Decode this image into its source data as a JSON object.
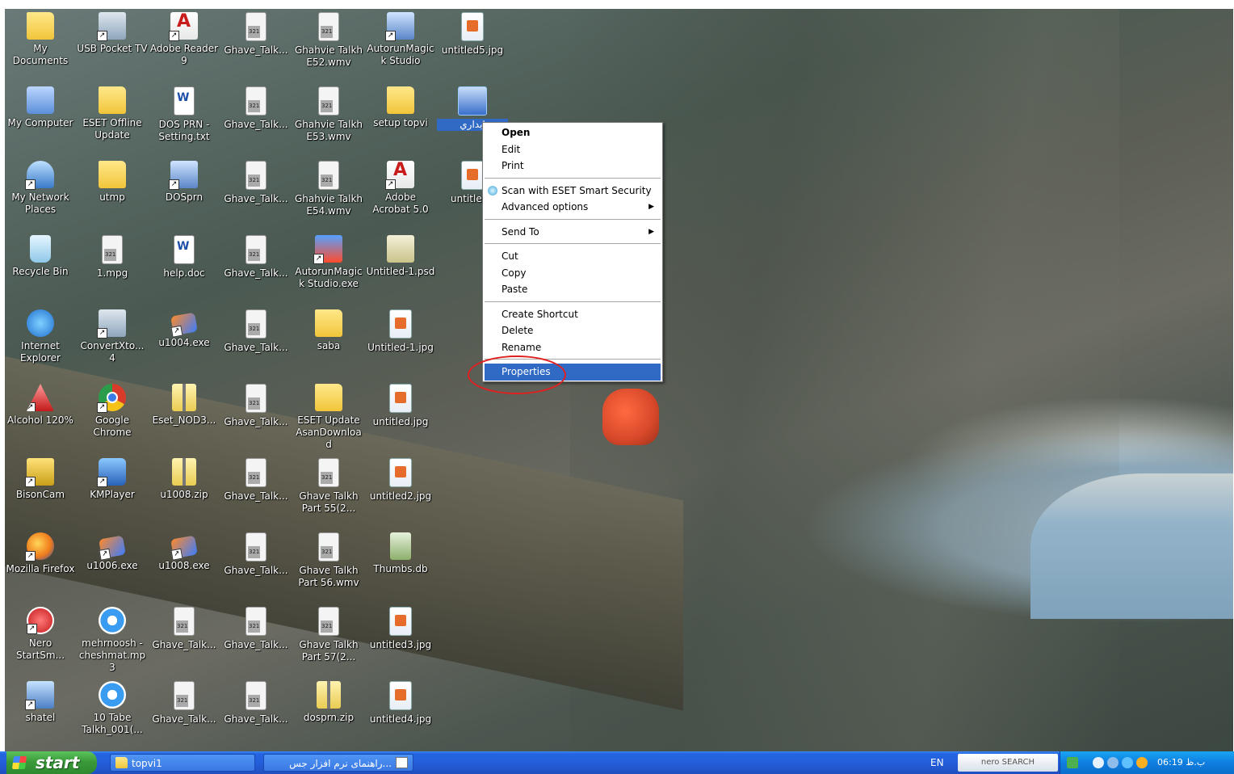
{
  "desktop_icons": [
    {
      "label": "My Documents",
      "kind": "folder"
    },
    {
      "label": "USB Pocket TV",
      "kind": "generic"
    },
    {
      "label": "Adobe Reader 9",
      "kind": "pdf"
    },
    {
      "label": "Ghave_Talk...",
      "kind": "video"
    },
    {
      "label": "Ghahvie Talkh E52.wmv",
      "kind": "video"
    },
    {
      "label": "AutorunMagick Studio",
      "kind": "app"
    },
    {
      "label": "untitled5.jpg",
      "kind": "jpg"
    },
    {
      "label": "My Computer",
      "kind": "pc"
    },
    {
      "label": "ESET Offline Update",
      "kind": "folder"
    },
    {
      "label": "DOS PRN - Setting.txt",
      "kind": "doc"
    },
    {
      "label": "Ghave_Talk...",
      "kind": "video"
    },
    {
      "label": "Ghahvie Talkh E53.wmv",
      "kind": "video"
    },
    {
      "label": "setup topvi",
      "kind": "folder"
    },
    {
      "label": "ابداري",
      "kind": "selected"
    },
    {
      "label": "My Network Places",
      "kind": "net"
    },
    {
      "label": "utmp",
      "kind": "folder"
    },
    {
      "label": "DOSprn",
      "kind": "app"
    },
    {
      "label": "Ghave_Talk...",
      "kind": "video"
    },
    {
      "label": "Ghahvie Talkh E54.wmv",
      "kind": "video"
    },
    {
      "label": "Adobe Acrobat 5.0",
      "kind": "pdf"
    },
    {
      "label": "untitled6",
      "kind": "jpg"
    },
    {
      "label": "Recycle Bin",
      "kind": "bin"
    },
    {
      "label": "1.mpg",
      "kind": "video"
    },
    {
      "label": "help.doc",
      "kind": "doc"
    },
    {
      "label": "Ghave_Talk...",
      "kind": "video"
    },
    {
      "label": "AutorunMagick Studio.exe",
      "kind": "mrt"
    },
    {
      "label": "Untitled-1.psd",
      "kind": "psd"
    },
    {
      "label": "Internet Explorer",
      "kind": "ie"
    },
    {
      "label": "ConvertXto... 4",
      "kind": "generic"
    },
    {
      "label": "u1004.exe",
      "kind": "exe"
    },
    {
      "label": "Ghave_Talk...",
      "kind": "video"
    },
    {
      "label": "saba",
      "kind": "folder"
    },
    {
      "label": "Untitled-1.jpg",
      "kind": "jpg"
    },
    {
      "label": "Alcohol 120%",
      "kind": "alcohol"
    },
    {
      "label": "Google Chrome",
      "kind": "chrome"
    },
    {
      "label": "Eset_NOD3...",
      "kind": "zip"
    },
    {
      "label": "Ghave_Talk...",
      "kind": "video"
    },
    {
      "label": "ESET Update AsanDownload",
      "kind": "folder"
    },
    {
      "label": "untitled.jpg",
      "kind": "jpg"
    },
    {
      "label": "BisonCam",
      "kind": "bison"
    },
    {
      "label": "KMPlayer",
      "kind": "kmp"
    },
    {
      "label": "u1008.zip",
      "kind": "zip"
    },
    {
      "label": "Ghave_Talk...",
      "kind": "video"
    },
    {
      "label": "Ghave Talkh Part 55(2...",
      "kind": "video"
    },
    {
      "label": "untitled2.jpg",
      "kind": "jpg"
    },
    {
      "label": "Mozilla Firefox",
      "kind": "ff"
    },
    {
      "label": "u1006.exe",
      "kind": "exe"
    },
    {
      "label": "u1008.exe",
      "kind": "exe"
    },
    {
      "label": "Ghave_Talk...",
      "kind": "video"
    },
    {
      "label": "Ghave Talkh Part 56.wmv",
      "kind": "video"
    },
    {
      "label": "Thumbs.db",
      "kind": "db"
    },
    {
      "label": "Nero StartSm...",
      "kind": "nero"
    },
    {
      "label": "mehrnoosh - cheshmat.mp3",
      "kind": "media"
    },
    {
      "label": "Ghave_Talk...",
      "kind": "video"
    },
    {
      "label": "Ghave_Talk...",
      "kind": "video"
    },
    {
      "label": "Ghave Talkh Part 57(2...",
      "kind": "video"
    },
    {
      "label": "untitled3.jpg",
      "kind": "jpg"
    },
    {
      "label": "shatel",
      "kind": "shatel"
    },
    {
      "label": "10 Tabe Talkh_001(...",
      "kind": "media"
    },
    {
      "label": "Ghave_Talk...",
      "kind": "video"
    },
    {
      "label": "Ghave_Talk...",
      "kind": "video"
    },
    {
      "label": "dosprn.zip",
      "kind": "zip"
    },
    {
      "label": "untitled4.jpg",
      "kind": "jpg"
    }
  ],
  "context_menu": {
    "open": "Open",
    "edit": "Edit",
    "print": "Print",
    "scan": "Scan with ESET Smart Security",
    "advanced": "Advanced options",
    "send_to": "Send To",
    "cut": "Cut",
    "copy": "Copy",
    "paste": "Paste",
    "create_shortcut": "Create Shortcut",
    "delete": "Delete",
    "rename": "Rename",
    "properties": "Properties"
  },
  "taskbar": {
    "start_label": "start",
    "tasks": [
      "topvi1",
      "...راهنمای نرم افزار جس"
    ],
    "lang": "EN",
    "nero_search": "nero SEARCH",
    "clock": "06:19 ب.ظ"
  },
  "colors": {
    "selection": "#316ac5",
    "highlight_circle": "#e02020",
    "taskbar": "#245edb",
    "start_button": "#3a9a3a"
  }
}
